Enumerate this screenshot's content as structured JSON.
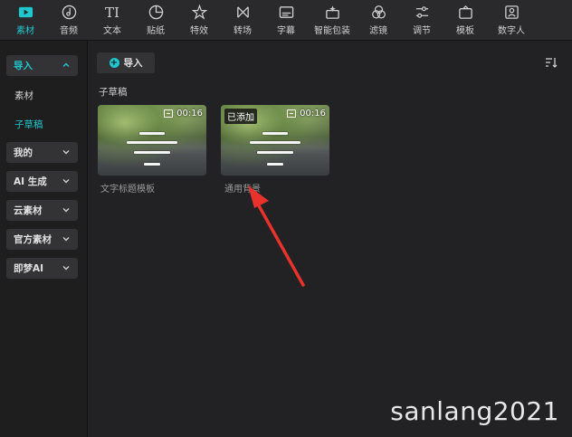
{
  "toolbar": {
    "items": [
      {
        "label": "素材",
        "icon": "media-play-icon",
        "active": true
      },
      {
        "label": "音频",
        "icon": "music-note-icon"
      },
      {
        "label": "文本",
        "icon": "text-tool-icon"
      },
      {
        "label": "贴纸",
        "icon": "sticker-icon"
      },
      {
        "label": "特效",
        "icon": "effects-star-icon"
      },
      {
        "label": "转场",
        "icon": "transition-bowtie-icon"
      },
      {
        "label": "字幕",
        "icon": "subtitle-icon"
      },
      {
        "label": "智能包装",
        "icon": "smart-package-icon"
      },
      {
        "label": "滤镜",
        "icon": "filter-icon"
      },
      {
        "label": "调节",
        "icon": "adjust-sliders-icon"
      },
      {
        "label": "模板",
        "icon": "template-icon"
      },
      {
        "label": "数字人",
        "icon": "digital-human-icon"
      }
    ],
    "accent": "#1fc7cf",
    "icon_text_glyph": "TI"
  },
  "sidebar": {
    "import_label": "导入",
    "sub_items": [
      "素材",
      "子草稿"
    ],
    "groups": [
      "我的",
      "AI 生成",
      "云素材",
      "官方素材",
      "即梦AI"
    ]
  },
  "main": {
    "import_button": "导入",
    "section_title": "子草稿",
    "cards": [
      {
        "title": "文字标题模板",
        "duration": "00:16",
        "added": ""
      },
      {
        "title": "通用背景",
        "duration": "00:16",
        "added": "已添加"
      }
    ]
  },
  "watermark": "sanlang2021"
}
